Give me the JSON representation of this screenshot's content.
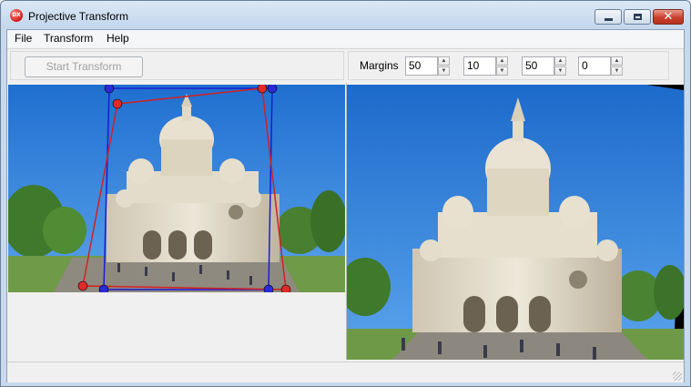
{
  "window": {
    "title": "Projective Transform",
    "app_icon_text": "DX",
    "close_glyph": "✕"
  },
  "menu": {
    "items": [
      {
        "label": "File"
      },
      {
        "label": "Transform"
      },
      {
        "label": "Help"
      }
    ]
  },
  "toolbar": {
    "start_button_label": "Start Transform",
    "start_button_enabled": false,
    "margins_label": "Margins",
    "margins": [
      {
        "value": "50"
      },
      {
        "value": "10"
      },
      {
        "value": "50"
      },
      {
        "value": "0"
      }
    ],
    "spin_up_glyph": "▲",
    "spin_down_glyph": "▼"
  },
  "colors": {
    "source_quad": "#1b1bd6",
    "target_quad": "#d42020",
    "sky": "#2f7bd6"
  }
}
